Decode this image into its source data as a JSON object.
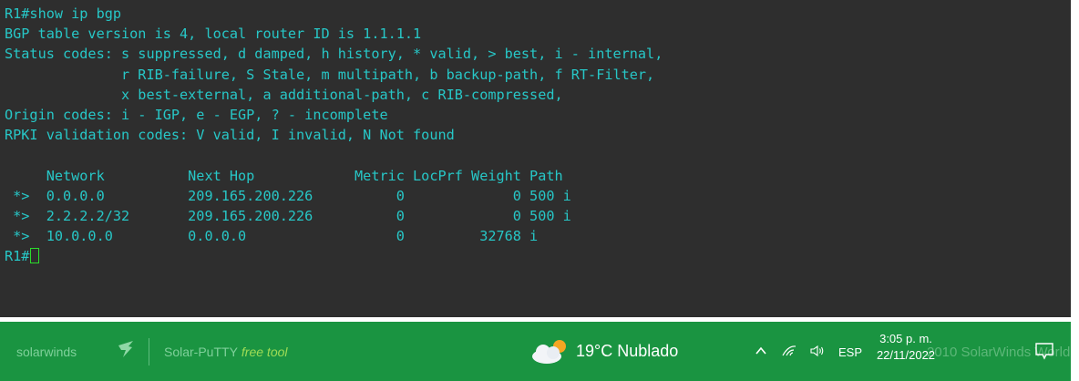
{
  "terminal": {
    "lines": [
      "R1#show ip bgp",
      "BGP table version is 4, local router ID is 1.1.1.1",
      "Status codes: s suppressed, d damped, h history, * valid, > best, i - internal,",
      "              r RIB-failure, S Stale, m multipath, b backup-path, f RT-Filter,",
      "              x best-external, a additional-path, c RIB-compressed,",
      "Origin codes: i - IGP, e - EGP, ? - incomplete",
      "RPKI validation codes: V valid, I invalid, N Not found",
      "",
      "     Network          Next Hop            Metric LocPrf Weight Path",
      " *>  0.0.0.0          209.165.200.226          0             0 500 i",
      " *>  2.2.2.2/32       209.165.200.226          0             0 500 i",
      " *>  10.0.0.0         0.0.0.0                  0         32768 i"
    ],
    "prompt": "R1#",
    "text_color": "#27c7c7",
    "background_color": "#2e2e2e",
    "cursor_color": "#2bdc2b"
  },
  "taskbar": {
    "brand": "solarwinds",
    "product": "Solar-PuTTY",
    "product_tag": "free tool",
    "watermark": "2010 SolarWinds World",
    "weather": {
      "icon": "cloud-sun-icon",
      "text": "19°C  Nublado"
    },
    "tray_icons": [
      "chevron-up-icon",
      "wifi-icon",
      "speaker-icon"
    ],
    "language": "ESP",
    "time": "3:05 p. m.",
    "date": "22/11/2022",
    "notification_icon": "notification-icon",
    "background_color": "#1a9441"
  }
}
